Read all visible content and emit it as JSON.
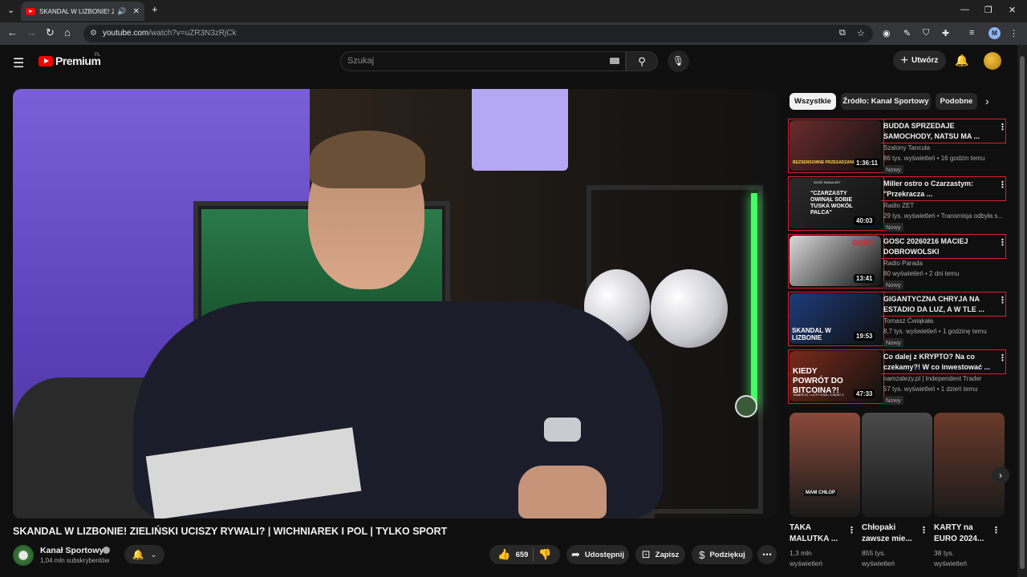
{
  "browser": {
    "tab_title": "SKANDAL W LIZBONIE! ZIE",
    "url_host": "youtube.com",
    "url_path": "/watch?v=uZR3N3zRjCk",
    "profile_initial": "M"
  },
  "masthead": {
    "logo_text": "Premium",
    "country": "PL",
    "search_placeholder": "Szukaj",
    "create_label": "Utwórz"
  },
  "video": {
    "title": "SKANDAL W LIZBONIE! ZIELIŃSKI UCISZY RYWALI? | WICHNIAREK I POL | TYLKO SPORT",
    "channel": "Kanał Sportowy",
    "subscribers": "1,04 mln subskrybentów",
    "likes": "659",
    "share_label": "Udostępnij",
    "save_label": "Zapisz",
    "thanks_label": "Podziękuj"
  },
  "chips": [
    "Wszystkie",
    "Źródło: Kanał Sportowy",
    "Podobne"
  ],
  "recommended": [
    {
      "title": "BUDDA SPRZEDAJE SAMOCHODY, NATSU MA ...",
      "channel": "Szalony Tancula",
      "meta": "86 tys. wyświetleń • 16 godzin temu",
      "badge": "Nowy",
      "duration": "1:36:11",
      "color": "#6b2c2c"
    },
    {
      "title": "Miller ostro o Czarzastym: \"Przekracza ...",
      "channel": "Radio ZET",
      "meta": "29 tys. wyświetleń • Transmisja odbyła s...",
      "badge": "Nowy",
      "duration": "40:03",
      "color": "#2a2a2a"
    },
    {
      "title": "GOSC 20260216 MACIEJ DOBROWOLSKI",
      "channel": "Radio Parada",
      "meta": "80 wyświetleń • 2 dni temu",
      "badge": "Nowy",
      "duration": "13:41",
      "color": "#d9d9d9"
    },
    {
      "title": "GIGANTYCZNA CHRYJA NA ESTADIO DA LUZ, A W TLE ...",
      "channel": "Tomasz Ćwiąkała",
      "meta": "8,7 tys. wyświetleń • 1 godzinę temu",
      "badge": "Nowy",
      "duration": "19:53",
      "color": "#1d3b7a"
    },
    {
      "title": "Co dalej z KRYPTO? Na co czekamy?! W co inwestować ...",
      "channel": "namzalezy.pl | Independent Trader",
      "meta": "57 tys. wyświetleń • 1 dzień temu",
      "badge": "Nowy",
      "duration": "47:33",
      "color": "#7a2a1a"
    }
  ],
  "thumb_text": {
    "r1": "BEZSENSOWNE PRZESADZANIE",
    "r2": "\"CZARZASTY OWINĄŁ SOBIE TUSKA WOKÓŁ PALCA\"",
    "r2b": "GOŚĆ RADIA ZET",
    "r3": "GOŚĆ",
    "r4": "SKANDAL W LIZBONIE",
    "r5": "KIEDY POWRÓT DO BITCOINA?!",
    "r5b": "TAMER 21 • LUTY 2026 • CZĘŚĆ 2"
  },
  "shorts": [
    {
      "title": "TAKA MALUTKA ...",
      "meta1": "1,3 mln",
      "meta2": "wyświetleń",
      "color": "#8a4a3a"
    },
    {
      "title": "Chłopaki zawsze mie...",
      "meta1": "855 tys.",
      "meta2": "wyświetleń",
      "color": "#4a4a4a"
    },
    {
      "title": "KARTY na EURO 2024...",
      "meta1": "38 tys.",
      "meta2": "wyświetleń",
      "color": "#6a3a2a"
    }
  ],
  "shorts_captions": {
    "s1": "MAM CHŁOP"
  },
  "icons": [
    "menu-icon",
    "search-icon",
    "mic-icon",
    "bell-icon",
    "like-icon",
    "dislike-icon",
    "share-icon",
    "save-icon",
    "thanks-icon",
    "more-icon",
    "chevron-right-icon"
  ],
  "colors": {
    "accent_red": "#ff0000",
    "highlight_outline": "#e31c2c",
    "background": "#0f0f0f"
  }
}
